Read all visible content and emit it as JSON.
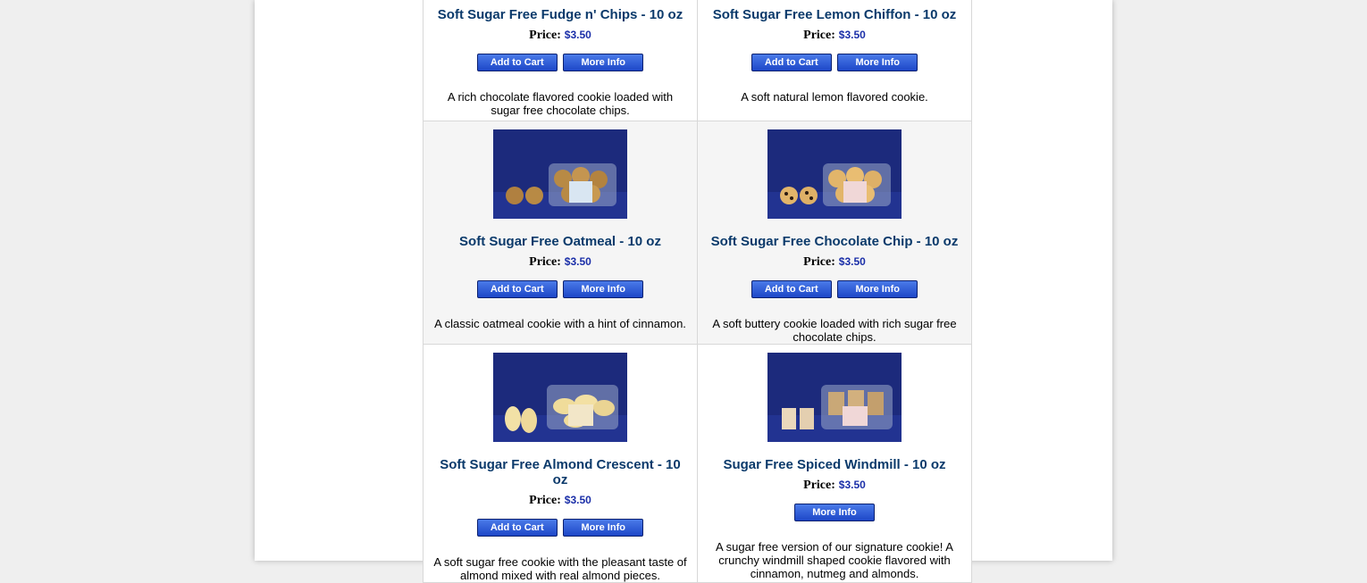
{
  "price_label": "Price:",
  "buttons": {
    "add_to_cart": "Add to Cart",
    "more_info": "More Info"
  },
  "products": [
    {
      "title": "Soft Sugar Free Fudge n' Chips - 10 oz",
      "price": "$3.50",
      "description": "A rich chocolate flavored cookie loaded with sugar free chocolate chips.",
      "has_add_to_cart": true
    },
    {
      "title": "Soft Sugar Free Lemon Chiffon - 10 oz",
      "price": "$3.50",
      "description": "A soft natural lemon flavored cookie.",
      "has_add_to_cart": true
    },
    {
      "title": "Soft Sugar Free Oatmeal - 10 oz",
      "price": "$3.50",
      "description": "A classic oatmeal cookie with a hint of cinnamon.",
      "has_add_to_cart": true
    },
    {
      "title": "Soft Sugar Free Chocolate Chip - 10 oz",
      "price": "$3.50",
      "description": "A soft buttery cookie loaded with rich sugar free chocolate chips.",
      "has_add_to_cart": true
    },
    {
      "title": "Soft Sugar Free Almond Crescent - 10 oz",
      "price": "$3.50",
      "description": "A soft sugar free cookie with the pleasant taste of almond mixed with real almond pieces.",
      "has_add_to_cart": true
    },
    {
      "title": "Sugar Free Spiced Windmill - 10 oz",
      "price": "$3.50",
      "description": "A sugar free version of our signature cookie! A crunchy windmill shaped cookie flavored with cinnamon, nutmeg and almonds.",
      "has_add_to_cart": false
    }
  ],
  "colors": {
    "title": "#0b3a6b",
    "price": "#1a2ea8",
    "button": "#1d47c8",
    "photo_backdrop": "#1c2a7c"
  }
}
